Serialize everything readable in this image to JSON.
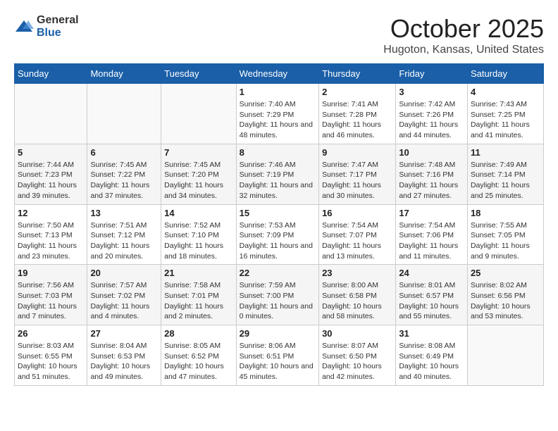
{
  "app": {
    "logo_general": "General",
    "logo_blue": "Blue"
  },
  "header": {
    "title": "October 2025",
    "subtitle": "Hugoton, Kansas, United States"
  },
  "calendar": {
    "days_of_week": [
      "Sunday",
      "Monday",
      "Tuesday",
      "Wednesday",
      "Thursday",
      "Friday",
      "Saturday"
    ],
    "weeks": [
      [
        {
          "day": "",
          "info": ""
        },
        {
          "day": "",
          "info": ""
        },
        {
          "day": "",
          "info": ""
        },
        {
          "day": "1",
          "info": "Sunrise: 7:40 AM\nSunset: 7:29 PM\nDaylight: 11 hours and 48 minutes."
        },
        {
          "day": "2",
          "info": "Sunrise: 7:41 AM\nSunset: 7:28 PM\nDaylight: 11 hours and 46 minutes."
        },
        {
          "day": "3",
          "info": "Sunrise: 7:42 AM\nSunset: 7:26 PM\nDaylight: 11 hours and 44 minutes."
        },
        {
          "day": "4",
          "info": "Sunrise: 7:43 AM\nSunset: 7:25 PM\nDaylight: 11 hours and 41 minutes."
        }
      ],
      [
        {
          "day": "5",
          "info": "Sunrise: 7:44 AM\nSunset: 7:23 PM\nDaylight: 11 hours and 39 minutes."
        },
        {
          "day": "6",
          "info": "Sunrise: 7:45 AM\nSunset: 7:22 PM\nDaylight: 11 hours and 37 minutes."
        },
        {
          "day": "7",
          "info": "Sunrise: 7:45 AM\nSunset: 7:20 PM\nDaylight: 11 hours and 34 minutes."
        },
        {
          "day": "8",
          "info": "Sunrise: 7:46 AM\nSunset: 7:19 PM\nDaylight: 11 hours and 32 minutes."
        },
        {
          "day": "9",
          "info": "Sunrise: 7:47 AM\nSunset: 7:17 PM\nDaylight: 11 hours and 30 minutes."
        },
        {
          "day": "10",
          "info": "Sunrise: 7:48 AM\nSunset: 7:16 PM\nDaylight: 11 hours and 27 minutes."
        },
        {
          "day": "11",
          "info": "Sunrise: 7:49 AM\nSunset: 7:14 PM\nDaylight: 11 hours and 25 minutes."
        }
      ],
      [
        {
          "day": "12",
          "info": "Sunrise: 7:50 AM\nSunset: 7:13 PM\nDaylight: 11 hours and 23 minutes."
        },
        {
          "day": "13",
          "info": "Sunrise: 7:51 AM\nSunset: 7:12 PM\nDaylight: 11 hours and 20 minutes."
        },
        {
          "day": "14",
          "info": "Sunrise: 7:52 AM\nSunset: 7:10 PM\nDaylight: 11 hours and 18 minutes."
        },
        {
          "day": "15",
          "info": "Sunrise: 7:53 AM\nSunset: 7:09 PM\nDaylight: 11 hours and 16 minutes."
        },
        {
          "day": "16",
          "info": "Sunrise: 7:54 AM\nSunset: 7:07 PM\nDaylight: 11 hours and 13 minutes."
        },
        {
          "day": "17",
          "info": "Sunrise: 7:54 AM\nSunset: 7:06 PM\nDaylight: 11 hours and 11 minutes."
        },
        {
          "day": "18",
          "info": "Sunrise: 7:55 AM\nSunset: 7:05 PM\nDaylight: 11 hours and 9 minutes."
        }
      ],
      [
        {
          "day": "19",
          "info": "Sunrise: 7:56 AM\nSunset: 7:03 PM\nDaylight: 11 hours and 7 minutes."
        },
        {
          "day": "20",
          "info": "Sunrise: 7:57 AM\nSunset: 7:02 PM\nDaylight: 11 hours and 4 minutes."
        },
        {
          "day": "21",
          "info": "Sunrise: 7:58 AM\nSunset: 7:01 PM\nDaylight: 11 hours and 2 minutes."
        },
        {
          "day": "22",
          "info": "Sunrise: 7:59 AM\nSunset: 7:00 PM\nDaylight: 11 hours and 0 minutes."
        },
        {
          "day": "23",
          "info": "Sunrise: 8:00 AM\nSunset: 6:58 PM\nDaylight: 10 hours and 58 minutes."
        },
        {
          "day": "24",
          "info": "Sunrise: 8:01 AM\nSunset: 6:57 PM\nDaylight: 10 hours and 55 minutes."
        },
        {
          "day": "25",
          "info": "Sunrise: 8:02 AM\nSunset: 6:56 PM\nDaylight: 10 hours and 53 minutes."
        }
      ],
      [
        {
          "day": "26",
          "info": "Sunrise: 8:03 AM\nSunset: 6:55 PM\nDaylight: 10 hours and 51 minutes."
        },
        {
          "day": "27",
          "info": "Sunrise: 8:04 AM\nSunset: 6:53 PM\nDaylight: 10 hours and 49 minutes."
        },
        {
          "day": "28",
          "info": "Sunrise: 8:05 AM\nSunset: 6:52 PM\nDaylight: 10 hours and 47 minutes."
        },
        {
          "day": "29",
          "info": "Sunrise: 8:06 AM\nSunset: 6:51 PM\nDaylight: 10 hours and 45 minutes."
        },
        {
          "day": "30",
          "info": "Sunrise: 8:07 AM\nSunset: 6:50 PM\nDaylight: 10 hours and 42 minutes."
        },
        {
          "day": "31",
          "info": "Sunrise: 8:08 AM\nSunset: 6:49 PM\nDaylight: 10 hours and 40 minutes."
        },
        {
          "day": "",
          "info": ""
        }
      ]
    ]
  }
}
